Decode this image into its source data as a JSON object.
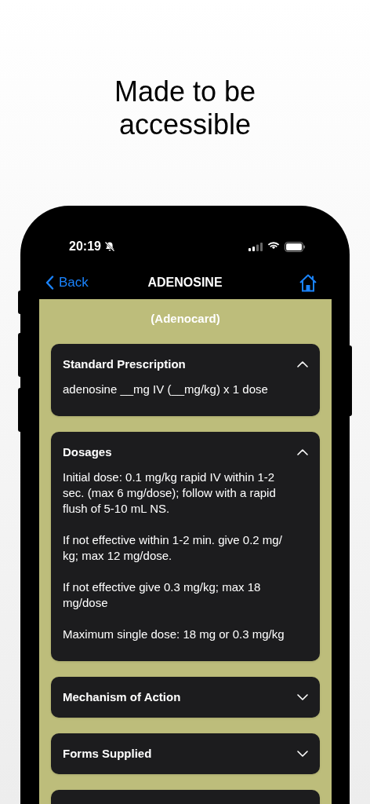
{
  "headline": "Made to be accessible",
  "status_bar": {
    "time": "20:19",
    "silent": true
  },
  "nav": {
    "back": "Back",
    "title": "ADENOSINE"
  },
  "subtitle": "(Adenocard)",
  "sections": [
    {
      "title": "Standard Prescription",
      "expanded": true,
      "paragraphs": [
        "adenosine __mg IV (__mg/kg) x 1 dose"
      ]
    },
    {
      "title": "Dosages",
      "expanded": true,
      "paragraphs": [
        "Initial dose: 0.1 mg/kg rapid IV within 1-2 sec. (max 6 mg/dose); follow with a rapid flush of 5-10 mL NS.",
        "If not effective within 1-2 min. give 0.2 mg/ kg; max 12 mg/dose.",
        "If not effective give 0.3 mg/kg; max 18 mg/dose",
        "Maximum single dose: 18 mg or 0.3 mg/kg"
      ]
    },
    {
      "title": "Mechanism of Action",
      "expanded": false
    },
    {
      "title": "Forms Supplied",
      "expanded": false
    }
  ]
}
